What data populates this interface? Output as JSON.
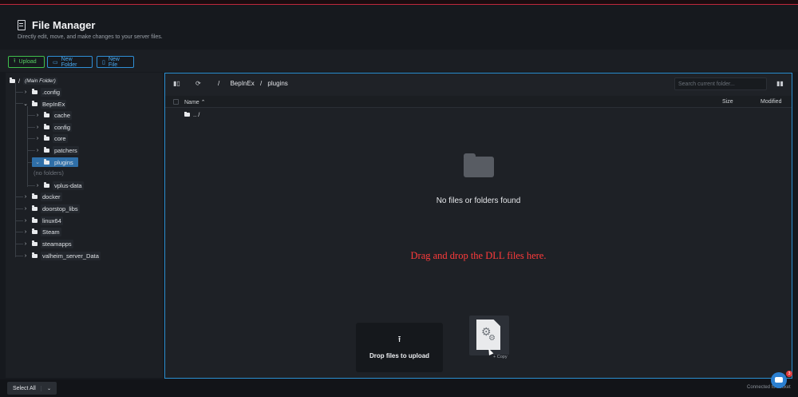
{
  "header": {
    "title": "File Manager",
    "subtitle": "Directly edit, move, and make changes to your server files."
  },
  "actions": {
    "upload": "Upload",
    "new_folder": "New Folder",
    "new_file": "New File"
  },
  "tree": {
    "root_slash": "/",
    "root_label": "(Main Folder)",
    "items": [
      {
        "label": ".config"
      },
      {
        "label": "BepInEx"
      },
      {
        "label": "cache"
      },
      {
        "label": "config"
      },
      {
        "label": "core"
      },
      {
        "label": "patchers"
      },
      {
        "label": "plugins"
      },
      {
        "label": "vplus-data"
      },
      {
        "label": "docker"
      },
      {
        "label": "doorstop_libs"
      },
      {
        "label": "linux64"
      },
      {
        "label": "Steam"
      },
      {
        "label": "steamapps"
      },
      {
        "label": "valheim_server_Data"
      }
    ],
    "no_folders": "(no folders)"
  },
  "breadcrumb": [
    "/",
    "BepInEx",
    "/",
    "plugins"
  ],
  "search": {
    "placeholder": "Search current folder..."
  },
  "columns": {
    "name": "Name ⌃",
    "size": "Size",
    "modified": "Modified"
  },
  "parent_row": ".. /",
  "empty_message": "No files or folders found",
  "annotation": "Drag and drop the DLL files here.",
  "dropzone": {
    "icon": "upload-icon",
    "text": "Drop files to upload"
  },
  "drag": {
    "copy_label": "+ Copy"
  },
  "footer": {
    "select_all": "Select All",
    "connected": "Connected to socket",
    "badge": "3"
  },
  "colors": {
    "accent": "#2a8fd0",
    "upload": "#3fbf4c",
    "annotation": "#ff3b3b",
    "selected": "#2f6fa8"
  }
}
